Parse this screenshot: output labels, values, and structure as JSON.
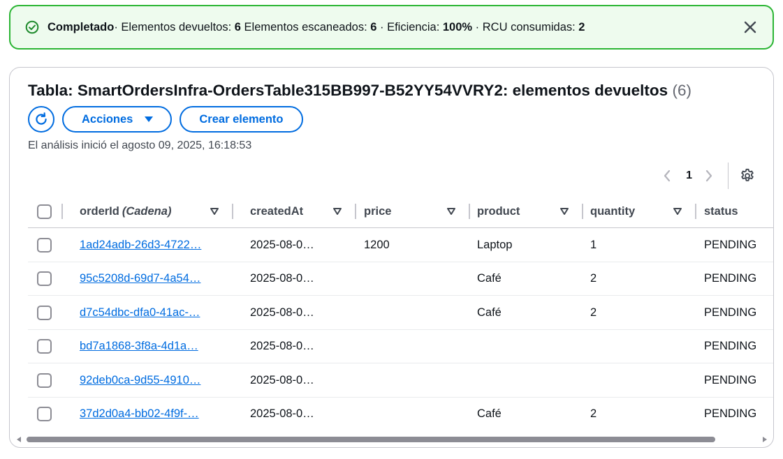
{
  "flash": {
    "status": "Completado",
    "returned_label": "· Elementos devueltos: ",
    "returned_value": "6",
    "scanned_label": " Elementos escaneados: ",
    "scanned_value": "6",
    "efficiency_label": " · Eficiencia: ",
    "efficiency_value": "100%",
    "rcu_label": " · RCU consumidas: ",
    "rcu_value": "2",
    "icon": "check-circle-icon",
    "close_icon": "close-icon",
    "color": "#2bb534"
  },
  "header": {
    "title": "Tabla: SmartOrdersInfra-OrdersTable315BB997-B52YY54VVRY2: elementos devueltos",
    "count": "(6)",
    "refresh_icon": "refresh-icon",
    "actions_label": "Acciones",
    "create_label": "Crear elemento",
    "scan_info": "El análisis inició el agosto 09, 2025, 16:18:53"
  },
  "pagination": {
    "page": "1",
    "prev_icon": "chevron-left-icon",
    "next_icon": "chevron-right-icon",
    "settings_icon": "gear-icon"
  },
  "table": {
    "columns": [
      {
        "label": "orderId",
        "type": "(Cadena)"
      },
      {
        "label": "createdAt"
      },
      {
        "label": "price"
      },
      {
        "label": "product"
      },
      {
        "label": "quantity"
      },
      {
        "label": "status"
      }
    ],
    "rows": [
      {
        "orderId": "1ad24adb-26d3-4722…",
        "createdAt": "2025-08-0…",
        "price": "1200",
        "product": "Laptop",
        "quantity": "1",
        "status": "PENDING"
      },
      {
        "orderId": "95c5208d-69d7-4a54…",
        "createdAt": "2025-08-0…",
        "price": "",
        "product": "Café",
        "quantity": "2",
        "status": "PENDING"
      },
      {
        "orderId": "d7c54dbc-dfa0-41ac-…",
        "createdAt": "2025-08-0…",
        "price": "",
        "product": "Café",
        "quantity": "2",
        "status": "PENDING"
      },
      {
        "orderId": "bd7a1868-3f8a-4d1a…",
        "createdAt": "2025-08-0…",
        "price": "",
        "product": "",
        "quantity": "",
        "status": "PENDING"
      },
      {
        "orderId": "92deb0ca-9d55-4910…",
        "createdAt": "2025-08-0…",
        "price": "",
        "product": "",
        "quantity": "",
        "status": "PENDING"
      },
      {
        "orderId": "37d2d0a4-bb02-4f9f-…",
        "createdAt": "2025-08-0…",
        "price": "",
        "product": "Café",
        "quantity": "2",
        "status": "PENDING"
      }
    ]
  },
  "colors": {
    "accent": "#006ce0",
    "success": "#2bb534",
    "success_bg": "#eefbee",
    "border": "#c6c6cd"
  },
  "scrollbar": {
    "visible_fraction": 0.943
  }
}
